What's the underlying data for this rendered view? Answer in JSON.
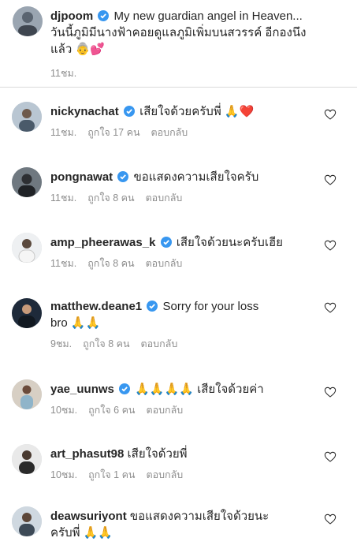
{
  "colors": {
    "verified": "#3897f0",
    "muted": "#8e8e8e",
    "text": "#262626",
    "heart": "#e8334a"
  },
  "caption": {
    "username": "djpoom",
    "text_line1": "My new guardian angel in Heaven...",
    "text_line2": "วันนี้ภูมิมีนางฟ้าคอยดูแลภูมิเพิ่มบนสวรรค์ อีกองนึง",
    "text_line3": "แล้ว",
    "emoji": "👵💕",
    "time": "11ชม."
  },
  "comments": [
    {
      "username": "nickynachat",
      "verified": true,
      "text": "เสียใจด้วยครับพี่",
      "emoji": "🙏❤️",
      "time": "11ชม.",
      "likes": "ถูกใจ 17 คน",
      "reply": "ตอบกลับ"
    },
    {
      "username": "pongnawat",
      "verified": true,
      "text": "ขอแสดงความเสียใจครับ",
      "emoji": "",
      "time": "11ชม.",
      "likes": "ถูกใจ 8 คน",
      "reply": "ตอบกลับ"
    },
    {
      "username": "amp_pheerawas_k",
      "verified": true,
      "text": "เสียใจด้วยนะครับเฮีย",
      "emoji": "",
      "time": "11ชม.",
      "likes": "ถูกใจ 8 คน",
      "reply": "ตอบกลับ"
    },
    {
      "username": "matthew.deane1",
      "verified": true,
      "text": "Sorry for your loss",
      "text2": "bro",
      "emoji": "🙏🙏",
      "time": "9ชม.",
      "likes": "ถูกใจ 8 คน",
      "reply": "ตอบกลับ"
    },
    {
      "username": "yae_uunws",
      "verified": true,
      "text": "เสียใจด้วยค่า",
      "emoji": "🙏🙏🙏🙏",
      "time": "10ชม.",
      "likes": "ถูกใจ 6 คน",
      "reply": "ตอบกลับ"
    },
    {
      "username": "art_phasut98",
      "verified": false,
      "text": "เสียใจด้วยพี่",
      "emoji": "",
      "time": "10ชม.",
      "likes": "ถูกใจ 1 คน",
      "reply": "ตอบกลับ"
    },
    {
      "username": "deawsuriyont",
      "verified": false,
      "text": "ขอแสดงความเสียใจด้วยนะ",
      "text2": "ครับพี่",
      "emoji": "🙏🙏",
      "time": "",
      "likes": "",
      "reply": ""
    }
  ]
}
